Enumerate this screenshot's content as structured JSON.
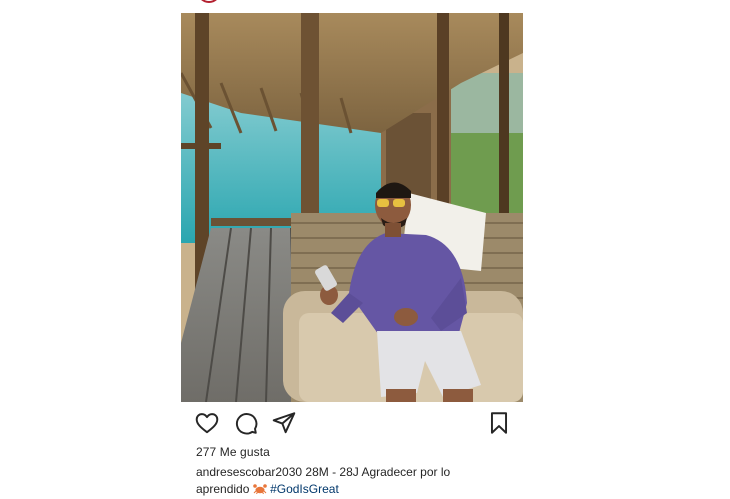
{
  "post": {
    "likes_text": "277 Me gusta",
    "username": "andresescobar2030",
    "caption_text": "28M - 28J Agradecer por lo aprendido",
    "emoji": "crab-icon",
    "hashtag": "#GodIsGreat"
  },
  "actions": {
    "like_icon": "heart-icon",
    "comment_icon": "comment-icon",
    "share_icon": "send-icon",
    "save_icon": "bookmark-icon"
  },
  "colors": {
    "brand_ring": "#b3202f",
    "text": "#262626",
    "hashtag": "#00376b"
  }
}
